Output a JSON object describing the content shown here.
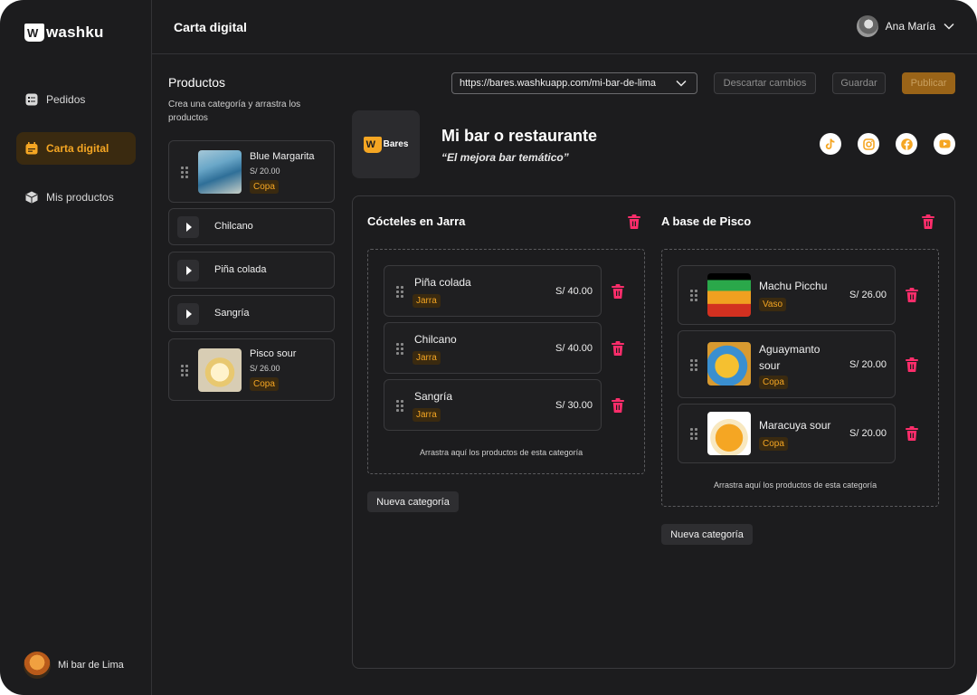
{
  "brand": {
    "name": "washku"
  },
  "sidebar": {
    "items": [
      {
        "label": "Pedidos",
        "icon": "orders-icon"
      },
      {
        "label": "Carta digital",
        "icon": "calendar-icon",
        "active": true
      },
      {
        "label": "Mis productos",
        "icon": "box-icon"
      }
    ],
    "bar_profile": "Mi bar de Lima"
  },
  "header": {
    "title": "Carta digital",
    "user_name": "Ana María"
  },
  "products": {
    "title": "Productos",
    "subtitle": "Crea una categoría y arrastra los productos",
    "items": [
      {
        "name": "Blue Margarita",
        "price": "S/ 20.00",
        "tag": "Copa",
        "expanded": true
      },
      {
        "name": "Chilcano"
      },
      {
        "name": "Piña colada"
      },
      {
        "name": "Sangría"
      },
      {
        "name": "Pisco sour",
        "price": "S/ 26.00",
        "tag": "Copa",
        "expanded": true
      }
    ]
  },
  "toolbar": {
    "url": "https://bares.washkuapp.com/mi-bar-de-lima",
    "discard_label": "Descartar cambios",
    "save_label": "Guardar",
    "publish_label": "Publicar"
  },
  "bar": {
    "logo_text": "Bares",
    "name": "Mi bar o restaurante",
    "slogan": "“El mejora bar temático”",
    "socials": [
      "tiktok-icon",
      "instagram-icon",
      "facebook-icon",
      "youtube-icon"
    ]
  },
  "categories": [
    {
      "title": "Cócteles en Jarra",
      "items": [
        {
          "name": "Piña colada",
          "price": "S/ 40.00",
          "tag": "Jarra"
        },
        {
          "name": "Chilcano",
          "price": "S/ 40.00",
          "tag": "Jarra"
        },
        {
          "name": "Sangría",
          "price": "S/ 30.00",
          "tag": "Jarra"
        }
      ],
      "hint": "Arrastra aquí los productos de esta categoría",
      "new_label": "Nueva categoría"
    },
    {
      "title": "A base de Pisco",
      "items": [
        {
          "name": "Machu Picchu",
          "price": "S/ 26.00",
          "tag": "Vaso"
        },
        {
          "name": "Aguaymanto sour",
          "price": "S/ 20.00",
          "tag": "Copa"
        },
        {
          "name": "Maracuya sour",
          "price": "S/ 20.00",
          "tag": "Copa"
        }
      ],
      "hint": "Arrastra aquí los productos de esta categoría",
      "new_label": "Nueva categoría"
    }
  ],
  "colors": {
    "accent": "#f5a623",
    "danger": "#ff2d6b",
    "background": "#1c1c1e"
  }
}
